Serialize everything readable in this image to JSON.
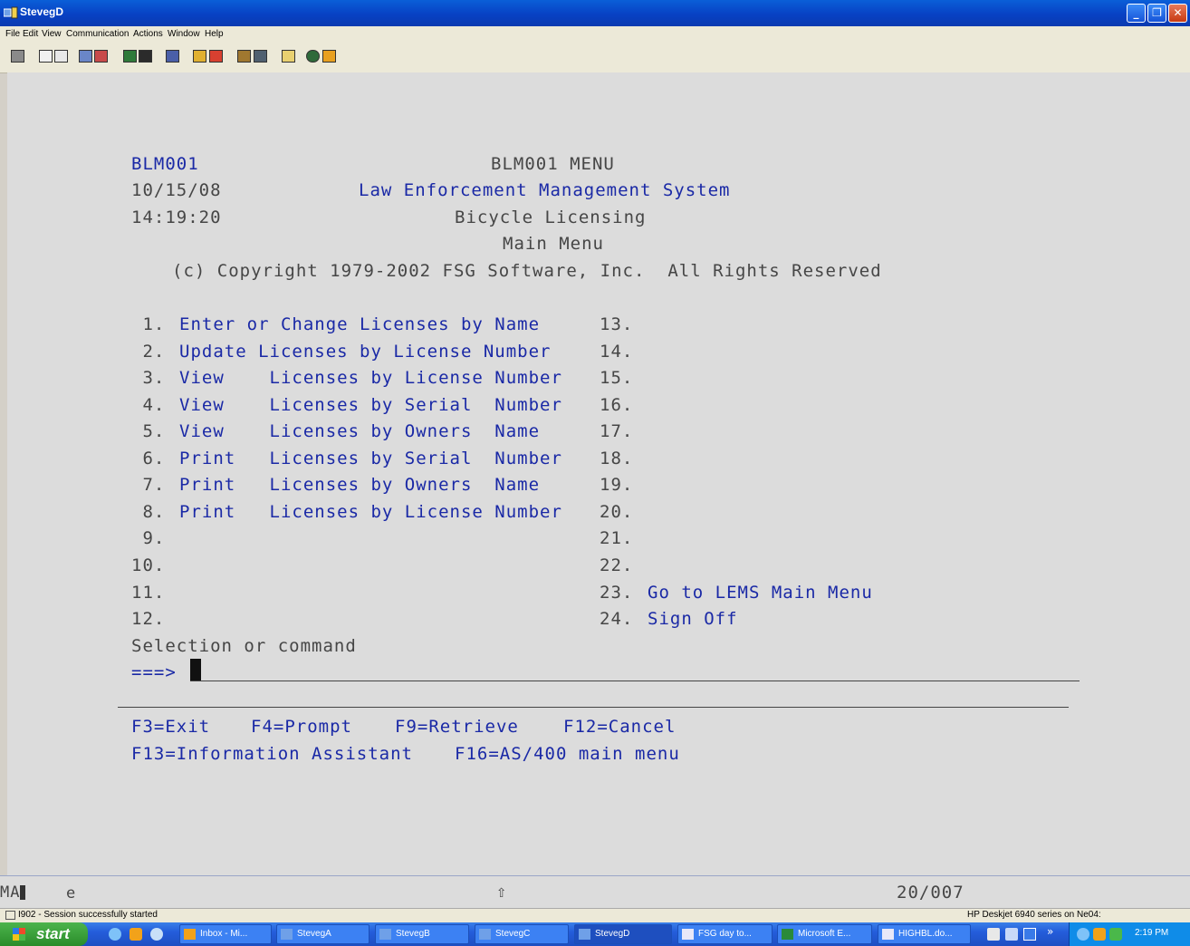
{
  "window": {
    "title": "StevegD"
  },
  "menu": [
    "File",
    "Edit",
    "View",
    "Communication",
    "Actions",
    "Window",
    "Help"
  ],
  "screen": {
    "program": "BLM001",
    "menu_title": "BLM001 MENU",
    "date": "10/15/08",
    "system_title": "Law Enforcement Management System",
    "time": "14:19:20",
    "subtitle": "Bicycle Licensing",
    "subtitle2": "Main Menu",
    "copyright": "(c) Copyright 1979-2002 FSG Software, Inc.  All Rights Reserved",
    "left_items": [
      {
        "num": " 1.",
        "label": "Enter or Change Licenses by Name"
      },
      {
        "num": " 2.",
        "label": "Update Licenses by License Number"
      },
      {
        "num": " 3.",
        "label": "View    Licenses by License Number"
      },
      {
        "num": " 4.",
        "label": "View    Licenses by Serial  Number"
      },
      {
        "num": " 5.",
        "label": "View    Licenses by Owners  Name"
      },
      {
        "num": " 6.",
        "label": "Print   Licenses by Serial  Number"
      },
      {
        "num": " 7.",
        "label": "Print   Licenses by Owners  Name"
      },
      {
        "num": " 8.",
        "label": "Print   Licenses by License Number"
      },
      {
        "num": " 9.",
        "label": ""
      },
      {
        "num": "10.",
        "label": ""
      },
      {
        "num": "11.",
        "label": ""
      },
      {
        "num": "12.",
        "label": ""
      }
    ],
    "right_items": [
      {
        "num": "13.",
        "label": ""
      },
      {
        "num": "14.",
        "label": ""
      },
      {
        "num": "15.",
        "label": ""
      },
      {
        "num": "16.",
        "label": ""
      },
      {
        "num": "17.",
        "label": ""
      },
      {
        "num": "18.",
        "label": ""
      },
      {
        "num": "19.",
        "label": ""
      },
      {
        "num": "20.",
        "label": ""
      },
      {
        "num": "21.",
        "label": ""
      },
      {
        "num": "22.",
        "label": ""
      },
      {
        "num": "23.",
        "label": "Go to LEMS Main Menu"
      },
      {
        "num": "24.",
        "label": "Sign Off"
      }
    ],
    "prompt_label": "Selection or command",
    "prompt_arrow": "===>",
    "command_value": "",
    "fkeys_line1": [
      "F3=Exit",
      "F4=Prompt",
      "F9=Retrieve",
      "F12=Cancel"
    ],
    "fkeys_line2": [
      "F13=Information Assistant",
      "F16=AS/400 main menu"
    ]
  },
  "oia": {
    "indicator": "MA",
    "mode": "e",
    "shift_symbol": "⇧",
    "cursor_pos": "20/007"
  },
  "statusbar": {
    "message": "I902 - Session successfully started",
    "printer": "HP Deskjet 6940 series on Ne04:"
  },
  "taskbar": {
    "start_label": "start",
    "items": [
      "Inbox - Mi...",
      "StevegA",
      "StevegB",
      "StevegC",
      "StevegD",
      "FSG day to...",
      "Microsoft E...",
      "HIGHBL.do..."
    ],
    "clock": "2:19 PM"
  }
}
